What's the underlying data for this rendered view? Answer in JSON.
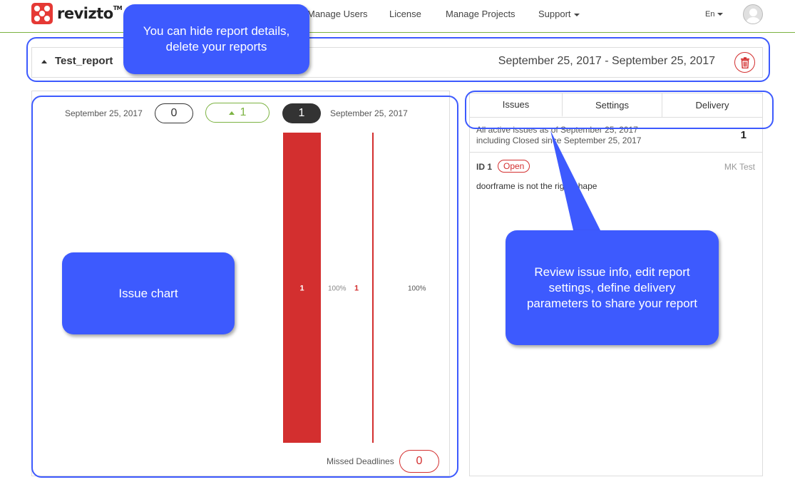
{
  "brand": {
    "name": "revizto",
    "tm": "TM"
  },
  "nav": {
    "links": [
      "Manage Users",
      "License",
      "Manage Projects",
      "Support"
    ],
    "language": "En"
  },
  "report": {
    "name": "Test_report",
    "range": "September 25, 2017 - September 25, 2017"
  },
  "chart": {
    "start_date": "September 25, 2017",
    "end_date": "September 25, 2017",
    "start_count": "0",
    "delta": "1",
    "end_count": "1",
    "missed_label": "Missed Deadlines",
    "missed_count": "0"
  },
  "chart_data": {
    "type": "bar",
    "categories": [
      "September 25, 2017",
      "September 25, 2017"
    ],
    "series": [
      {
        "values": [
          1,
          1
        ]
      }
    ],
    "labels": [
      {
        "value": "1",
        "percent": "100%"
      },
      {
        "value": "1",
        "percent": "100%"
      }
    ],
    "colors": [
      "#d32f2f",
      "#d32f2f"
    ]
  },
  "issues": {
    "tabs": [
      "Issues",
      "Settings",
      "Delivery"
    ],
    "summary_line1": "All active issues as of September 25, 2017",
    "summary_line2": "including Closed since September 25, 2017",
    "total": "1",
    "items": [
      {
        "id": "ID 1",
        "status": "Open",
        "author": "MK Test",
        "description": "doorframe is not the right shape"
      }
    ]
  },
  "annotations": {
    "header_note": "You can hide report details, delete your reports",
    "chart_note": "Issue chart",
    "panel_note": "Review issue info, edit report settings, define delivery parameters to share your report"
  },
  "colors": {
    "accent": "#3d5afe",
    "brand_red": "#e53935",
    "danger": "#d32f2f",
    "success": "#7cb342"
  }
}
